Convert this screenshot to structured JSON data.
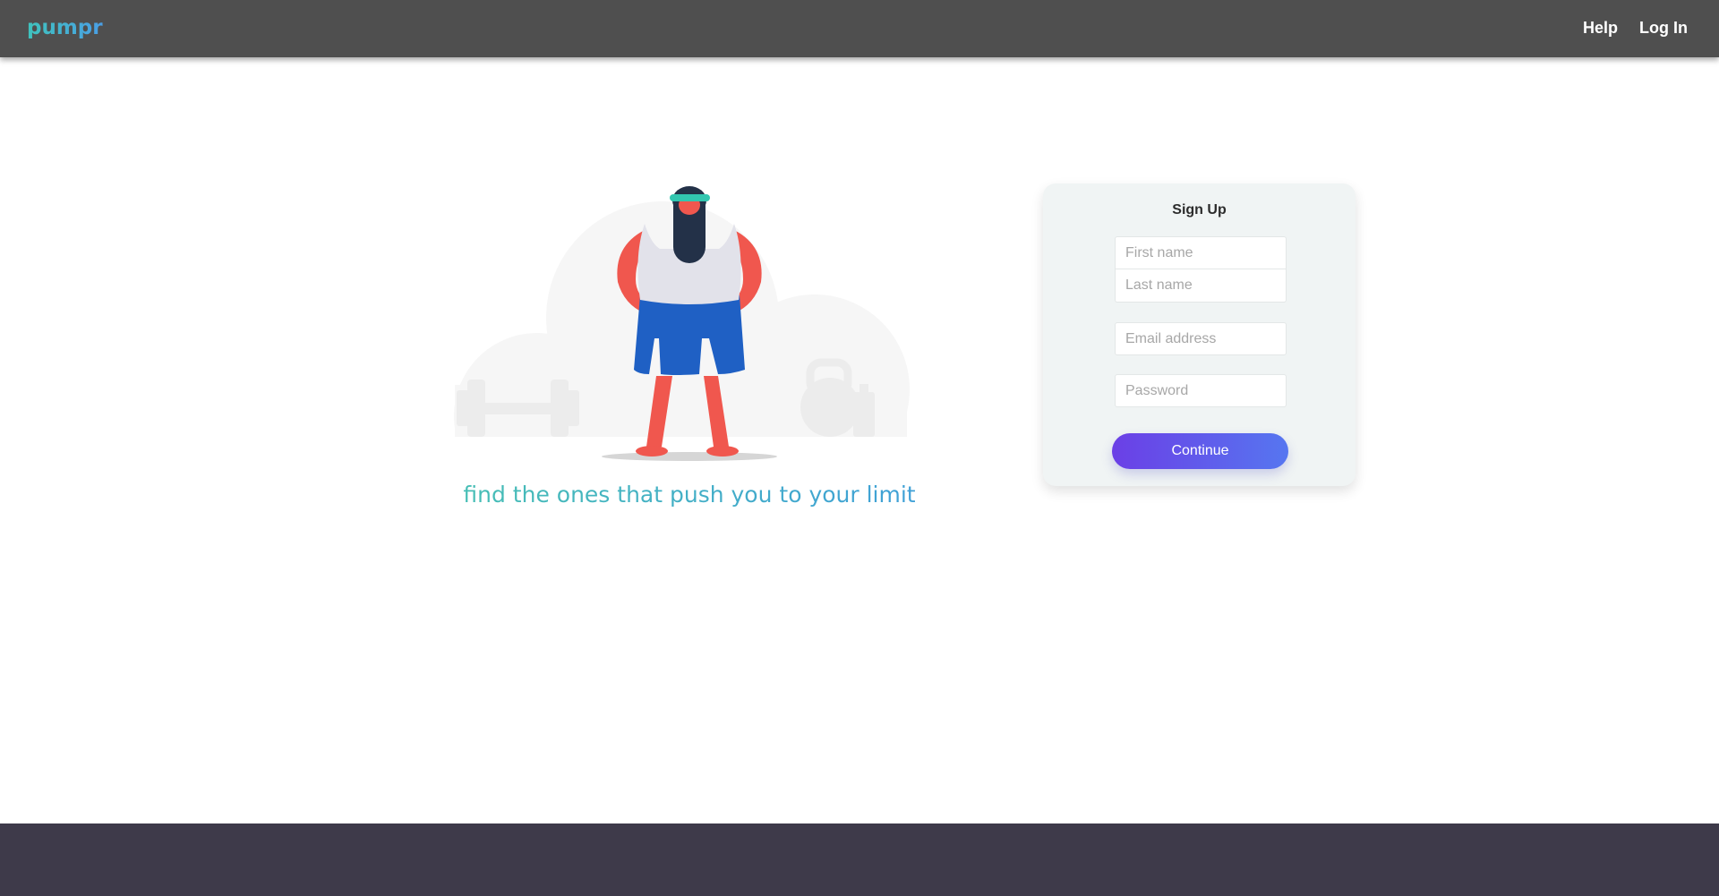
{
  "header": {
    "logo": "pumpr",
    "nav": {
      "help": "Help",
      "login": "Log In"
    }
  },
  "hero": {
    "illustration": "person-with-headband-and-beard-icon",
    "tagline": "find the ones that push you to your limit"
  },
  "signup": {
    "title": "Sign Up",
    "first_name_placeholder": "First name",
    "last_name_placeholder": "Last name",
    "email_placeholder": "Email address",
    "password_placeholder": "Password",
    "continue_label": "Continue"
  },
  "colors": {
    "topbar": "#4f4f4f",
    "accent_teal": "#47bfb4",
    "accent_blue": "#3f9fd8",
    "button_start": "#6b3fe6",
    "button_end": "#5676f0",
    "card_bg": "#f0f4f4",
    "footer": "#3e3a4a"
  }
}
